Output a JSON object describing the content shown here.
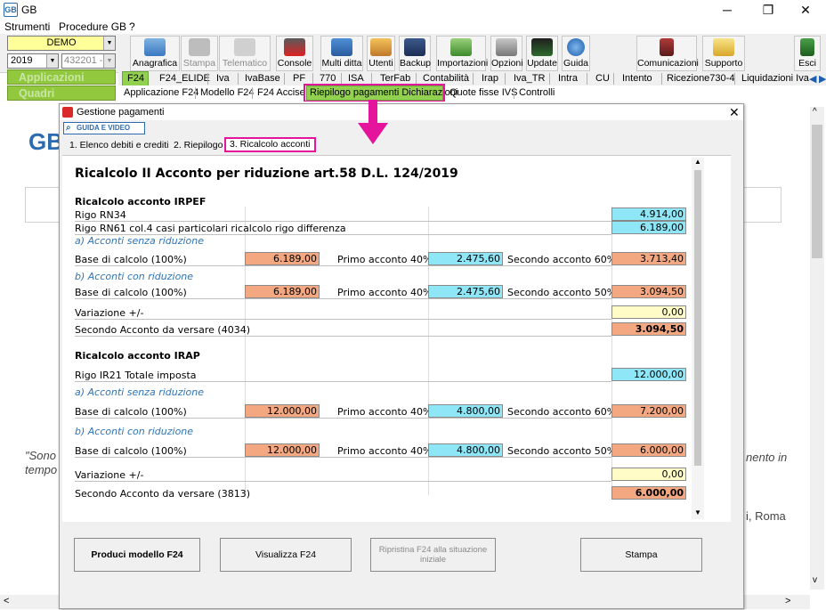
{
  "window": {
    "title": "GB",
    "icon": "GB",
    "minimize": "─",
    "restore": "❐",
    "close": "✕"
  },
  "menu": [
    "Strumenti",
    "Procedure GB",
    "?"
  ],
  "left": {
    "company": "DEMO",
    "year": "2019",
    "code": "432201 -",
    "applicazioni": "Applicazioni",
    "quadri": "Quadri"
  },
  "toolbar": {
    "anagrafica": "Anagrafica",
    "stampa": "Stampa",
    "telematico": "Telematico",
    "console": "Console",
    "multiditta": "Multi ditta",
    "utenti": "Utenti",
    "backup": "Backup",
    "importazioni": "Importazioni",
    "opzioni": "Opzioni",
    "update": "Update",
    "guida": "Guida",
    "comunicazioni": "Comunicazioni",
    "supporto": "Supporto",
    "esci": "Esci"
  },
  "tabs1": [
    "F24",
    "F24_ELIDE",
    "Iva",
    "IvaBase",
    "PF",
    "770",
    "ISA",
    "TerFab",
    "Contabilità",
    "Irap",
    "Iva_TR",
    "Intra",
    "CU",
    "Intento",
    "Ricezione730-4",
    "Liquidazioni Iva"
  ],
  "tabs2": [
    "Applicazione F24",
    "Modello F24",
    "F24 Accise",
    "Riepilogo pagamenti Dichiarazioni",
    "Quote fisse IVS",
    "Controlli"
  ],
  "background": {
    "logo": "GB",
    "quote": "\"Sono",
    "quote2": "tempo",
    "right1": "nento in",
    "right2": "i, Roma"
  },
  "dialog": {
    "title": "Gestione pagamenti",
    "guida": "GUIDA E VIDEO",
    "tabs": [
      "1. Elenco debiti e crediti",
      "2. Riepilogo",
      "3. Ricalcolo acconti"
    ],
    "heading": "Ricalcolo II Acconto per riduzione art.58 D.L. 124/2019",
    "irpef": {
      "title": "Ricalcolo acconto IRPEF",
      "rn34_label": "Rigo RN34",
      "rn34": "4.914,00",
      "rn61_label": "Rigo RN61 col.4 casi particolari ricalcolo rigo differenza",
      "rn61": "6.189,00",
      "a_label": "a) Acconti senza riduzione",
      "a_base_label": "Base di calcolo (100%)",
      "a_base": "6.189,00",
      "a_primo_label": "Primo acconto 40%",
      "a_primo": "2.475,60",
      "a_secondo_label": "Secondo acconto 60%",
      "a_secondo": "3.713,40",
      "b_label": "b) Acconti con riduzione",
      "b_base_label": "Base di calcolo (100%)",
      "b_base": "6.189,00",
      "b_primo_label": "Primo acconto 40%",
      "b_primo": "2.475,60",
      "b_secondo_label": "Secondo acconto 50%",
      "b_secondo": "3.094,50",
      "var_label": "Variazione +/-",
      "var": "0,00",
      "tot_label": "Secondo Acconto da versare (4034)",
      "tot": "3.094,50"
    },
    "irap": {
      "title": "Ricalcolo acconto IRAP",
      "ir21_label": "Rigo IR21 Totale imposta",
      "ir21": "12.000,00",
      "a_label": "a) Acconti senza riduzione",
      "a_base_label": "Base di calcolo (100%)",
      "a_base": "12.000,00",
      "a_primo_label": "Primo acconto 40%",
      "a_primo": "4.800,00",
      "a_secondo_label": "Secondo acconto 60%",
      "a_secondo": "7.200,00",
      "b_label": "b) Acconti con riduzione",
      "b_base_label": "Base di calcolo (100%)",
      "b_base": "12.000,00",
      "b_primo_label": "Primo acconto 40%",
      "b_primo": "4.800,00",
      "b_secondo_label": "Secondo acconto 50%",
      "b_secondo": "6.000,00",
      "var_label": "Variazione +/-",
      "var": "0,00",
      "tot_label": "Secondo Acconto da versare (3813)",
      "tot": "6.000,00"
    },
    "buttons": {
      "produci": "Produci modello F24",
      "visualizza": "Visualizza F24",
      "ripristina": "Ripristina F24 alla situazione iniziale",
      "stampa": "Stampa"
    }
  },
  "colors": {
    "highlight": "#e4159c",
    "green": "#92d050",
    "cyan": "#8ee6f6",
    "orange": "#f4a882",
    "yellow": "#fffcc8"
  }
}
